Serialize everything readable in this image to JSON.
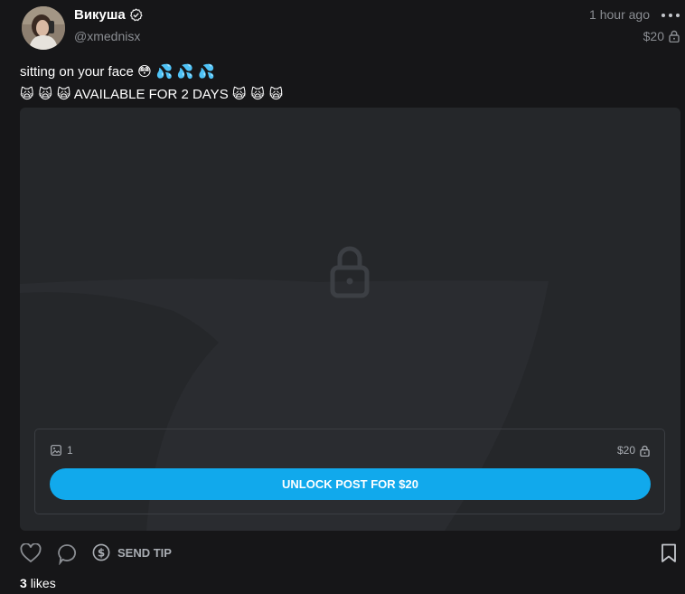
{
  "post": {
    "author": {
      "name": "Викуша",
      "handle": "@xmednisx",
      "verified": true
    },
    "time_ago": "1 hour ago",
    "price": "$20",
    "text_line1": "sitting on your face",
    "text_line1_emojis": "😳 💦 💦 💦",
    "text_line2_prefix_emojis": "🙀 🙀 🙀",
    "text_line2": "AVAILABLE FOR 2 DAYS",
    "text_line2_suffix_emojis": "🙀 🙀 🙀",
    "media": {
      "count": "1",
      "price": "$20",
      "unlock_label": "UNLOCK POST FOR $20"
    },
    "actions": {
      "tip_label": "SEND TIP"
    },
    "likes_count": "3",
    "likes_label": "likes"
  },
  "colors": {
    "background": "#161618",
    "media_bg": "#25272a",
    "accent": "#11a9ec",
    "muted_text": "#8a8d92"
  },
  "icons": [
    "verified-icon",
    "more-icon",
    "lock-icon",
    "image-icon",
    "heart-icon",
    "comment-icon",
    "dollar-icon",
    "bookmark-icon"
  ]
}
